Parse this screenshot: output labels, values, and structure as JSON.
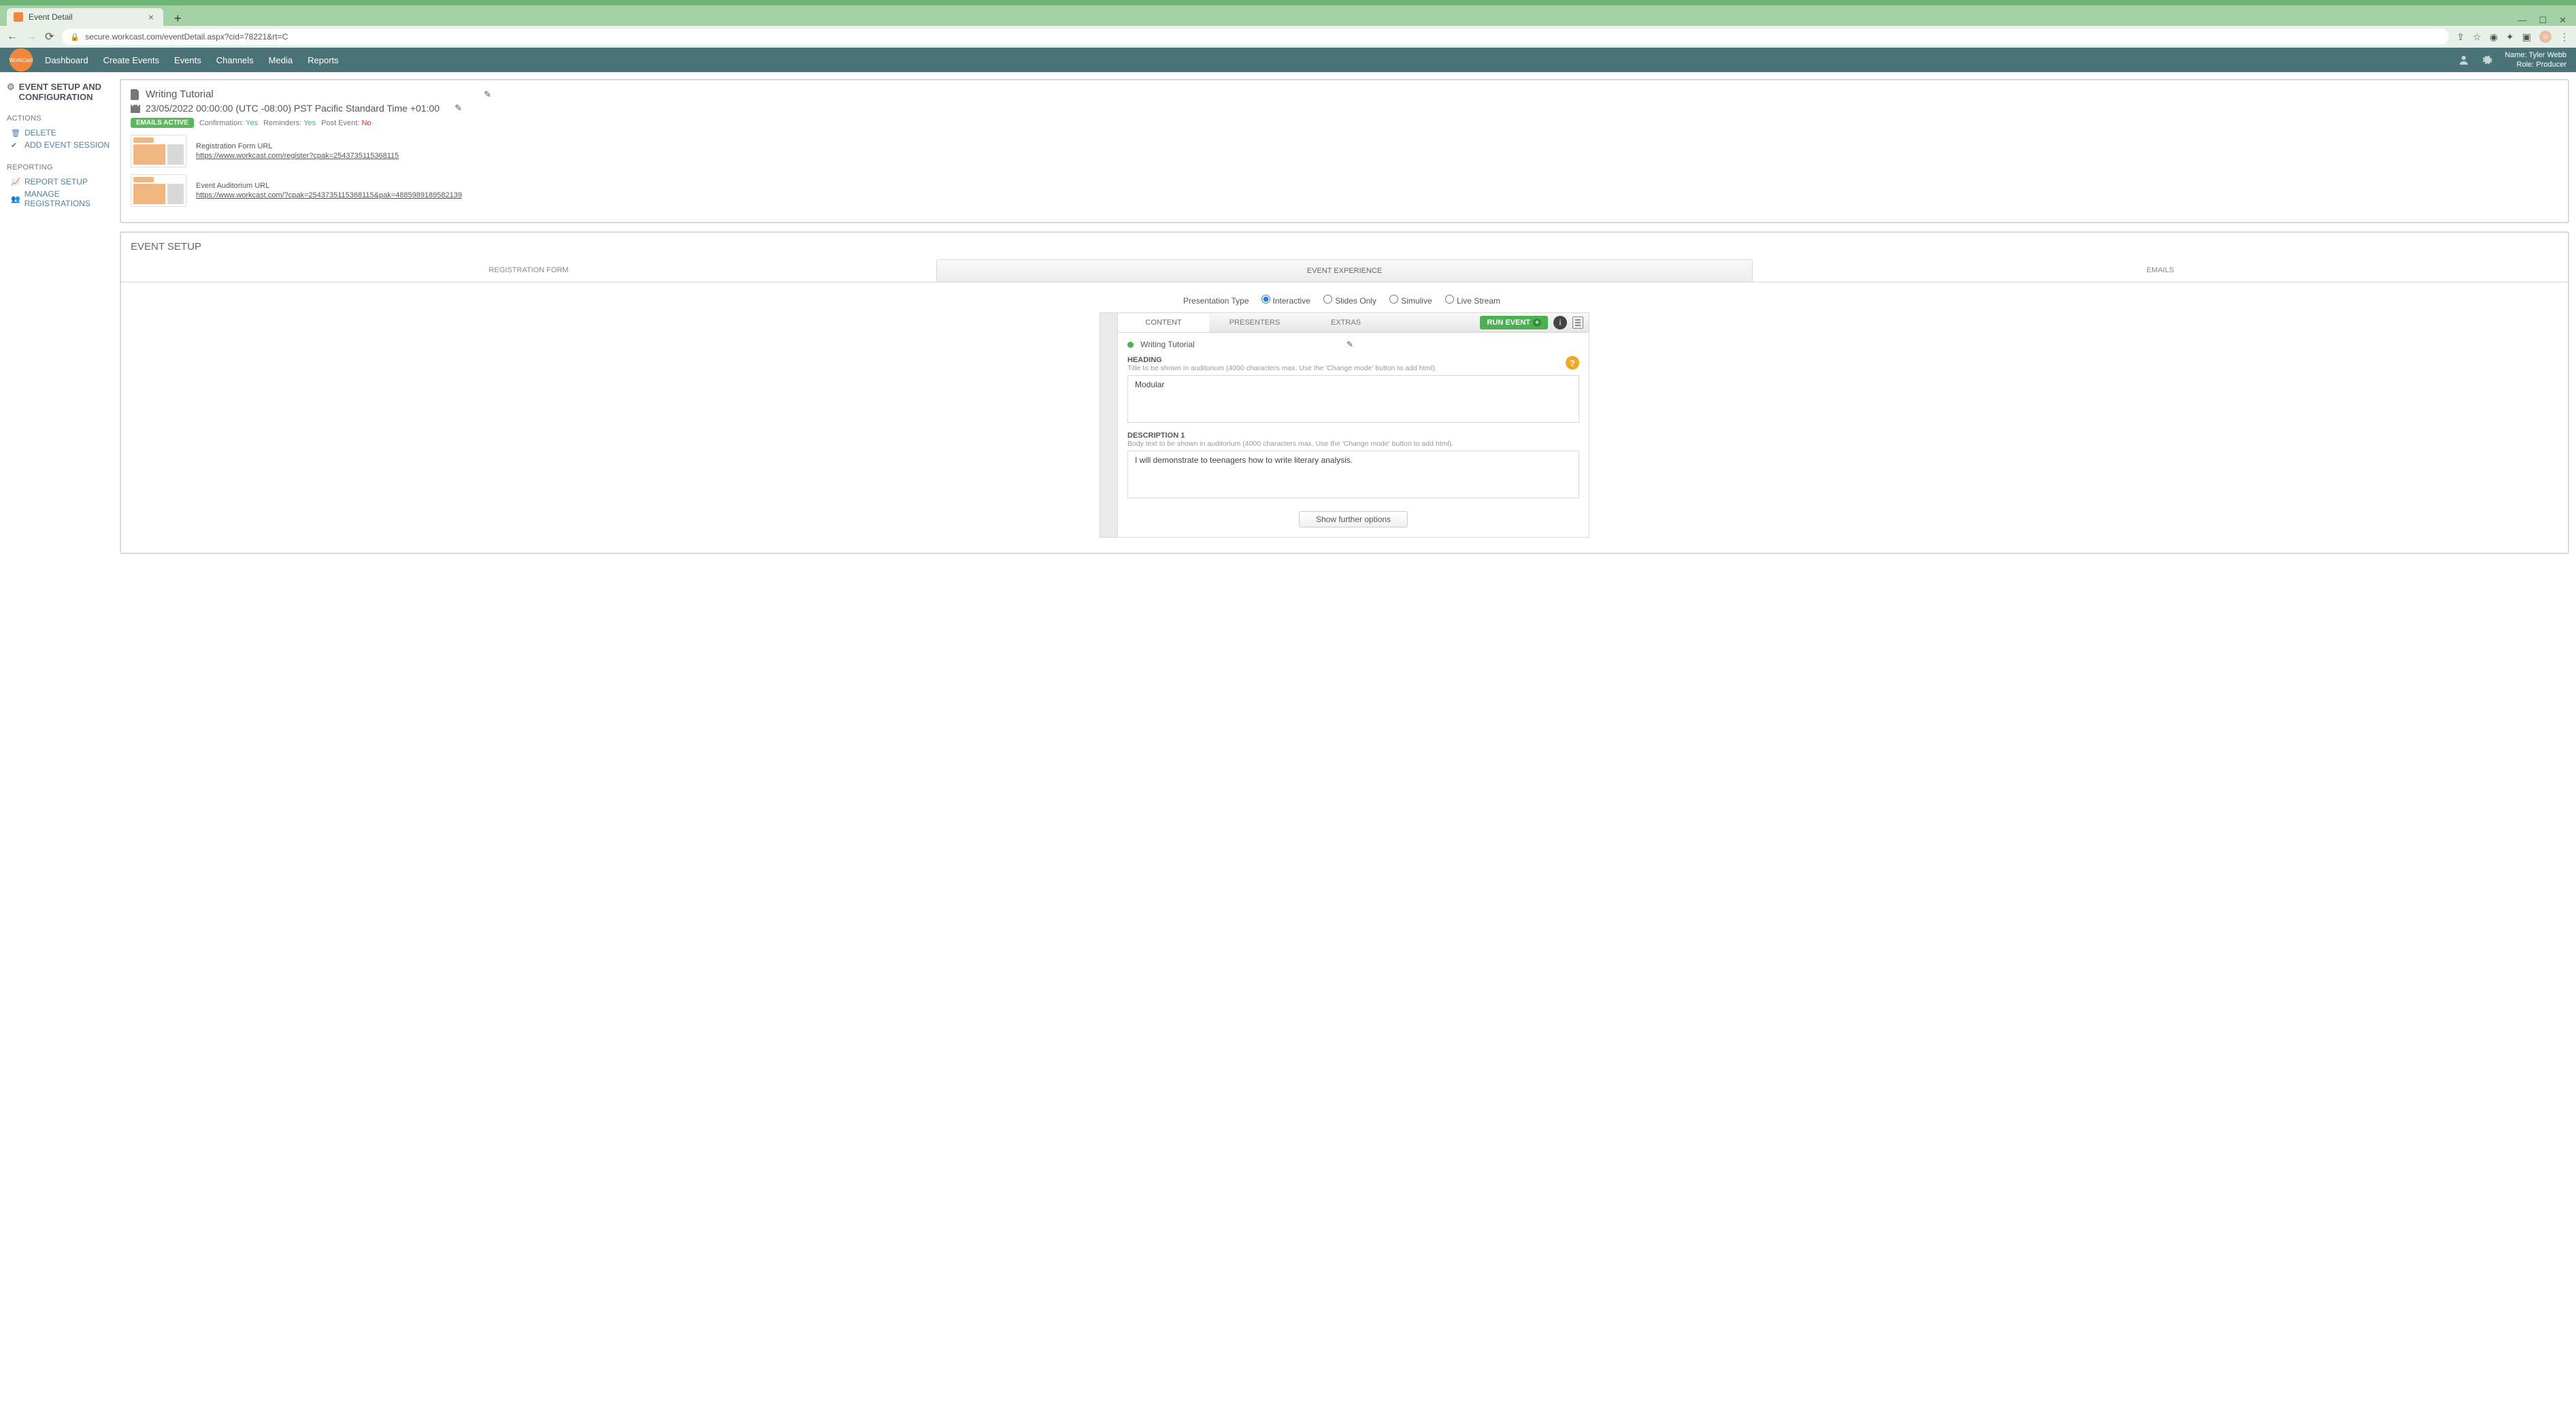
{
  "browser": {
    "tab_title": "Event Detail",
    "url": "secure.workcast.com/eventDetail.aspx?cid=78221&rt=C"
  },
  "app_nav": {
    "logo": "WorkCast",
    "links": [
      "Dashboard",
      "Create Events",
      "Events",
      "Channels",
      "Media",
      "Reports"
    ],
    "user": {
      "name_label": "Name: Tyler Webb",
      "role_label": "Role: Producer"
    }
  },
  "sidebar": {
    "title": "EVENT SETUP AND CONFIGURATION",
    "sections": {
      "actions": {
        "label": "ACTIONS",
        "items": [
          {
            "icon": "trash",
            "label": "DELETE"
          },
          {
            "icon": "check",
            "label": "ADD EVENT SESSION"
          }
        ]
      },
      "reporting": {
        "label": "REPORTING",
        "items": [
          {
            "icon": "chart",
            "label": "REPORT SETUP"
          },
          {
            "icon": "users",
            "label": "MANAGE REGISTRATIONS"
          }
        ]
      }
    }
  },
  "header_panel": {
    "event_title": "Writing Tutorial",
    "event_date": "23/05/2022 00:00:00 (UTC -08:00) PST Pacific Standard Time +01:00",
    "emails_badge": "EMAILS ACTIVE",
    "confirmation_label": "Confirmation:",
    "confirmation_value": "Yes",
    "reminders_label": "Reminders:",
    "reminders_value": "Yes",
    "postevent_label": "Post Event:",
    "postevent_value": "No",
    "reg_label": "Registration Form URL",
    "reg_url": "https://www.workcast.com/register?cpak=2543735115368115",
    "aud_label": "Event Auditorium URL",
    "aud_url": "https://www.workcast.com/?cpak=2543735115368115&pak=4885989189582139"
  },
  "setup": {
    "header": "EVENT SETUP",
    "main_tabs": [
      "REGISTRATION FORM",
      "EVENT EXPERIENCE",
      "EMAILS"
    ],
    "active_main_tab": 1,
    "pres_type_label": "Presentation Type",
    "pres_types": [
      "Interactive",
      "Slides Only",
      "Simulive",
      "Live Stream"
    ],
    "pres_type_selected": 0,
    "sub_tabs": [
      "CONTENT",
      "PRESENTERS",
      "EXTRAS"
    ],
    "active_sub_tab": 0,
    "run_event_label": "RUN EVENT",
    "session_name": "Writing Tutorial",
    "heading_label": "HEADING",
    "heading_hint": "Title to be shown in auditorium (4000 characters max. Use the 'Change mode' button to add html).",
    "heading_value": "Modular",
    "desc_label": "DESCRIPTION 1",
    "desc_hint": "Body text to be shown in auditorium (4000 characters max. Use the 'Change mode' button to add html).",
    "desc_value": "I will demonstrate to teenagers how to write literary analysis.",
    "show_further": "Show further options"
  }
}
